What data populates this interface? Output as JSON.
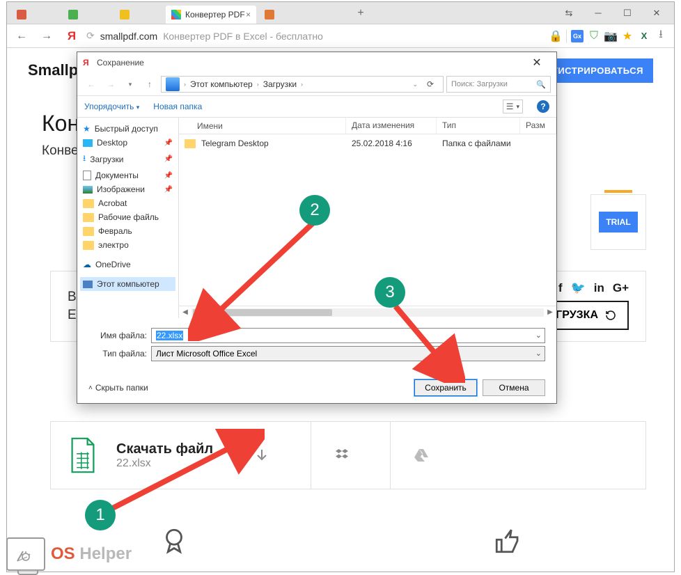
{
  "browser": {
    "active_tab_label": "Конвертер PDF",
    "url_domain": "smallpdf.com",
    "url_title": "Конвертер PDF в Excel - бесплатно"
  },
  "page": {
    "logo": "Smallp",
    "register_btn": "ГИСТРИРОВАТЬСЯ",
    "h1": "Конв",
    "sub": "Конвер",
    "trial": "TRIAL",
    "result_line1": "Ва",
    "result_line2": "E",
    "load_btn": "ГРУЗКА",
    "download_label": "Скачать файл",
    "download_filename": "22.xlsx"
  },
  "dialog": {
    "title": "Сохранение",
    "crumb1": "Этот компьютер",
    "crumb2": "Загрузки",
    "search_placeholder": "Поиск: Загрузки",
    "toolbar_organize": "Упорядочить",
    "toolbar_newfolder": "Новая папка",
    "tree": {
      "quick": "Быстрый доступ",
      "desktop": "Desktop",
      "downloads": "Загрузки",
      "documents": "Документы",
      "pictures": "Изображени",
      "acrobat": "Acrobat",
      "workfiles": "Рабочие файль",
      "feb": "Февраль",
      "electro": "электро",
      "onedrive": "OneDrive",
      "thispc": "Этот компьютер"
    },
    "columns": {
      "name": "Имени",
      "date": "Дата изменения",
      "type": "Тип",
      "size": "Разм"
    },
    "rows": [
      {
        "name": "Telegram Desktop",
        "date": "25.02.2018 4:16",
        "type": "Папка с файлами"
      }
    ],
    "filename_label": "Имя файла:",
    "filename_value": "22.xlsx",
    "filetype_label": "Тип файла:",
    "filetype_value": "Лист Microsoft Office Excel",
    "hide_folders": "Скрыть папки",
    "save_btn": "Сохранить",
    "cancel_btn": "Отмена"
  },
  "callouts": {
    "n1": "1",
    "n2": "2",
    "n3": "3"
  },
  "watermark": {
    "os": "OS",
    "helper": "Helper"
  }
}
